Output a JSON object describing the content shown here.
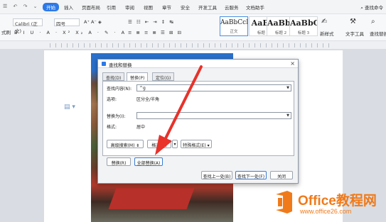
{
  "menubar": {
    "quick_access": "☰ ↶ ↷ ⌄",
    "tabs": [
      "开始",
      "插入",
      "页面布局",
      "引用",
      "审阅",
      "视图",
      "章节",
      "安全",
      "开发工具",
      "云服务",
      "文档助手"
    ],
    "search": "查找命令"
  },
  "ribbon": {
    "font_name": "Calibri (正文)",
    "font_size": "四号",
    "paste_label": "式刷",
    "styles": [
      {
        "preview": "AaBbCcI",
        "name": "正文"
      },
      {
        "preview": "AaBb",
        "name": "标题 1"
      },
      {
        "preview": "AaBbC",
        "name": "标题 2"
      },
      {
        "preview": "AaBbCc",
        "name": "标题 3"
      }
    ],
    "new_style": "新样式",
    "text_tools": "文字工具",
    "find_replace": "查找替换"
  },
  "dialog": {
    "title": "查找和替换",
    "tabs": [
      "查找(D)",
      "替换(P)",
      "定位(G)"
    ],
    "find_label": "查找内容(N):",
    "find_value": "^g",
    "find_options_label": "选项:",
    "find_options_value": "区分全/半角",
    "replace_label": "替换为(I):",
    "replace_value": "",
    "format_label": "格式:",
    "format_value": "居中",
    "buttons": {
      "advanced": "高级搜索(M) ⇟",
      "format": "格式(O)",
      "special": "▾",
      "clear_format": "特殊格式(E) ▾",
      "replace": "替换(R)",
      "replace_all": "全部替换(A)",
      "find_prev": "查找上一处(B)",
      "find_next": "查找下一处(F)",
      "close": "关闭"
    }
  },
  "watermark": {
    "brand": "Office教程网",
    "url": "www.office26.com"
  },
  "colors": {
    "accent": "#2c79e8",
    "arrow": "#e8322a",
    "watermark": "#f07a1a"
  }
}
